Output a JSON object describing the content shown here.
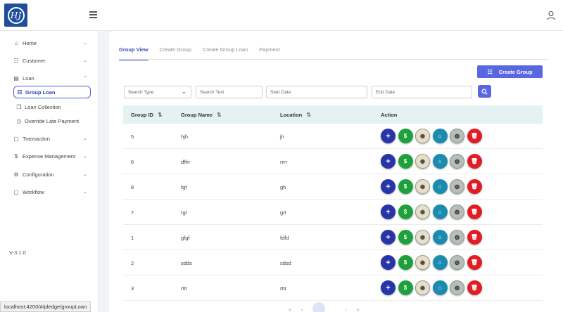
{
  "brand": {
    "logo_text": "HJ",
    "color": "#1f4e9c"
  },
  "sidebar": {
    "items": [
      {
        "label": "Home",
        "icon": "home-icon",
        "chevron": "expand-more"
      },
      {
        "label": "Customer",
        "icon": "users-icon",
        "chevron": "expand-more"
      },
      {
        "label": "Loan",
        "icon": "loan-icon",
        "chevron": "expand-less"
      },
      {
        "label": "Group Loan",
        "icon": "group-icon",
        "active": true
      },
      {
        "label": "Loan Collection",
        "icon": "collection-icon"
      },
      {
        "label": "Override Late Payment",
        "icon": "clock-icon"
      },
      {
        "label": "Transaction",
        "icon": "transaction-icon",
        "chevron": "expand-more"
      },
      {
        "label": "Expense Management",
        "icon": "dollar-icon",
        "chevron": "expand-more"
      },
      {
        "label": "Configuration",
        "icon": "gear-icon",
        "chevron": "expand-more"
      },
      {
        "label": "Workflow",
        "icon": "workflow-icon",
        "chevron": "expand-more"
      }
    ],
    "version": "V-3.1.0"
  },
  "tabs": [
    {
      "label": "Group View",
      "active": true
    },
    {
      "label": "Create Group"
    },
    {
      "label": "Create Group Loan"
    },
    {
      "label": "Payment"
    }
  ],
  "toolbar": {
    "create_label": "Create Group"
  },
  "filters": {
    "search_type": "Search Type",
    "search_text": "Search Text",
    "start_date": "Start Date",
    "end_date": "End Date"
  },
  "table": {
    "headers": [
      "Group ID",
      "Group Name",
      "Location",
      "Action"
    ],
    "rows": [
      {
        "id": "5",
        "name": "hjh",
        "location": "jh"
      },
      {
        "id": "6",
        "name": "dffrr",
        "location": "rrrr"
      },
      {
        "id": "8",
        "name": "fgf",
        "location": "gh"
      },
      {
        "id": "7",
        "name": "rgr",
        "location": "grt"
      },
      {
        "id": "1",
        "name": "gfgf",
        "location": "fdfd"
      },
      {
        "id": "2",
        "name": "sdds",
        "location": "sdsd"
      },
      {
        "id": "3",
        "name": "rttr",
        "location": "rttr"
      }
    ]
  },
  "status_url": "localhost:4200/#/pledge/groupLoan",
  "colors": {
    "accent": "#5968e0",
    "active_tab": "#3b4db8",
    "header_bg": "#e5f2f2"
  }
}
